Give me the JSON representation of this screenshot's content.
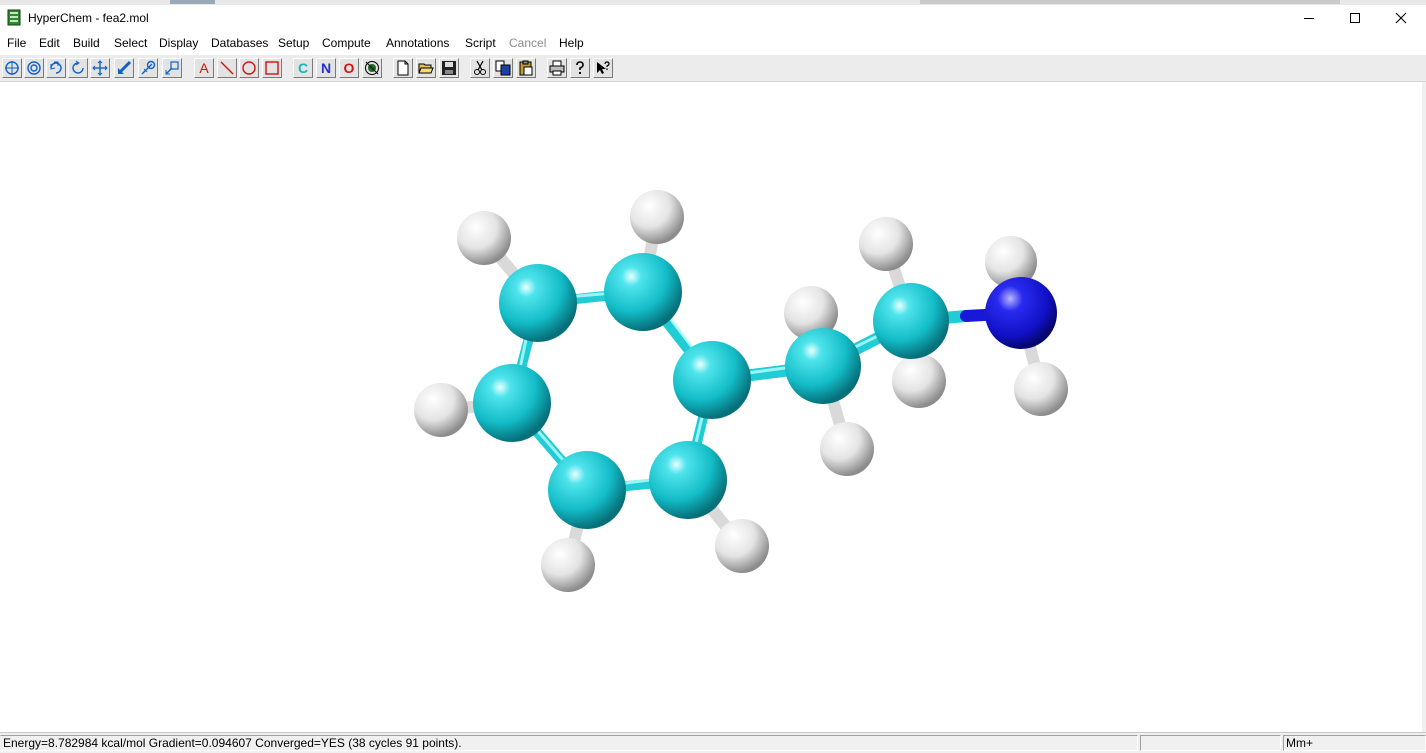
{
  "window": {
    "title": "HyperChem - fea2.mol"
  },
  "menu": {
    "items": [
      {
        "label": "File"
      },
      {
        "label": "Edit"
      },
      {
        "label": "Build"
      },
      {
        "label": "Select"
      },
      {
        "label": "Display"
      },
      {
        "label": "Databases"
      },
      {
        "label": "Setup"
      },
      {
        "label": "Compute"
      },
      {
        "label": "Annotations"
      },
      {
        "label": "Script"
      },
      {
        "label": "Cancel",
        "disabled": true
      },
      {
        "label": "Help"
      }
    ]
  },
  "toolbar": {
    "tools": [
      {
        "name": "select-tool-icon"
      },
      {
        "name": "draw-tool-icon"
      },
      {
        "name": "xy-rotate-icon"
      },
      {
        "name": "z-rotate-icon"
      },
      {
        "name": "xy-translate-icon"
      },
      {
        "name": "z-translate-icon"
      },
      {
        "name": "zoom-icon"
      },
      {
        "name": "clip-icon"
      },
      {
        "name": "text-annotation-icon",
        "label": "A"
      },
      {
        "name": "line-annotation-icon"
      },
      {
        "name": "ellipse-annotation-icon"
      },
      {
        "name": "rectangle-annotation-icon"
      },
      {
        "name": "carbon-element-button",
        "label": "C",
        "color": "#17b5c4"
      },
      {
        "name": "nitrogen-element-button",
        "label": "N",
        "color": "#1f34c8"
      },
      {
        "name": "oxygen-element-button",
        "label": "O",
        "color": "#d01212"
      },
      {
        "name": "periodic-table-icon"
      },
      {
        "name": "new-file-icon"
      },
      {
        "name": "open-folder-icon"
      },
      {
        "name": "save-disk-icon"
      },
      {
        "name": "cut-icon"
      },
      {
        "name": "copy-icon"
      },
      {
        "name": "paste-icon"
      },
      {
        "name": "print-icon"
      },
      {
        "name": "help-icon"
      },
      {
        "name": "context-help-icon"
      }
    ]
  },
  "molecule": {
    "name": "fea2.mol",
    "colors": {
      "carbon": "#13c4cf",
      "nitrogen": "#1616d8",
      "hydrogen": "#e6e6e6"
    },
    "atom_count": {
      "C": 8,
      "N": 1,
      "H": 11
    }
  },
  "status": {
    "message": "Energy=8.782984 kcal/mol Gradient=0.094607 Converged=YES (38 cycles 91 points).",
    "panel2": "",
    "panel3": "Mm+"
  }
}
